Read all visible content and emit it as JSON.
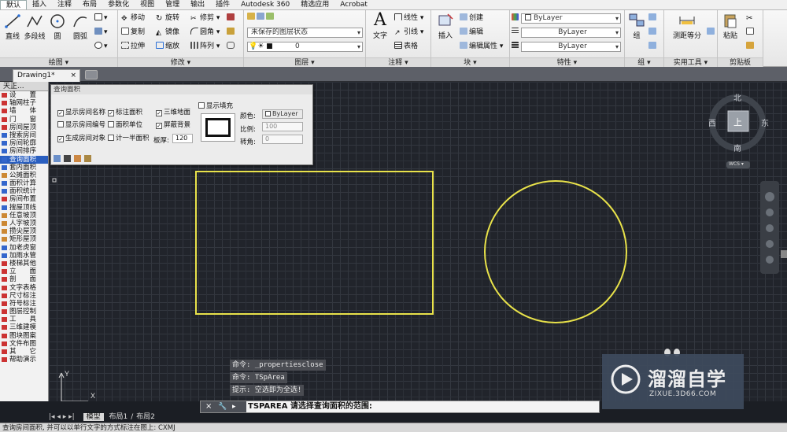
{
  "menu": [
    "默认",
    "插入",
    "注释",
    "布局",
    "参数化",
    "视图",
    "管理",
    "输出",
    "插件",
    "Autodesk 360",
    "精选应用",
    "Acrobat"
  ],
  "ribbon": {
    "draw": {
      "title": "绘图 ▾",
      "line": "直线",
      "polyline": "多段线",
      "circle": "圆",
      "arc": "圆弧"
    },
    "modify": {
      "title": "修改 ▾",
      "move": "移动",
      "rotate": "旋转",
      "trim": "修剪 ▾",
      "copy": "复制",
      "mirror": "镜像",
      "fillet": "圆角 ▾",
      "stretch": "拉伸",
      "scale": "缩放",
      "array": "阵列 ▾"
    },
    "layer": {
      "title": "图层 ▾",
      "state": "未保存的图层状态",
      "current": "0"
    },
    "annotation": {
      "title": "注释 ▾",
      "text": "文字",
      "linetype": "线性 ▾",
      "leader": "引线 ▾",
      "table": "表格"
    },
    "block": {
      "title": "块 ▾",
      "insert": "插入",
      "create": "创建",
      "edit": "编辑",
      "editattr": "编辑属性 ▾"
    },
    "properties": {
      "title": "特性 ▾",
      "color": "ByLayer",
      "linetype": "ByLayer",
      "lineweight": "ByLayer"
    },
    "group": {
      "title": "组 ▾",
      "label": "组"
    },
    "utilities": {
      "title": "实用工具 ▾",
      "measure": "测距等分"
    },
    "clipboard": {
      "title": "剪贴板",
      "paste": "粘贴"
    }
  },
  "doc_tab": "Drawing1*",
  "palette": {
    "title": "天正...",
    "items": [
      {
        "label": "设　　置",
        "color": "#cc3333"
      },
      {
        "label": "轴网柱子",
        "color": "#cc3333"
      },
      {
        "label": "墙　　体",
        "color": "#cc3333"
      },
      {
        "label": "门　　窗",
        "color": "#cc3333"
      },
      {
        "label": "房间屋顶",
        "color": "#cc3333"
      },
      {
        "label": "搜索房间",
        "color": "#3366cc"
      },
      {
        "label": "房间轮廓",
        "color": "#3366cc"
      },
      {
        "label": "房间排序",
        "color": "#3366cc"
      },
      {
        "label": "查询面积",
        "color": "#3366cc"
      },
      {
        "label": "套内面积",
        "color": "#3366cc"
      },
      {
        "label": "公摊面积",
        "color": "#cc8833"
      },
      {
        "label": "面积计算",
        "color": "#3366cc"
      },
      {
        "label": "面积统计",
        "color": "#3366cc"
      },
      {
        "label": "房间布置",
        "color": "#cc3333"
      },
      {
        "label": "搜屋顶线",
        "color": "#3366cc"
      },
      {
        "label": "任意坡顶",
        "color": "#cc8833"
      },
      {
        "label": "人字坡顶",
        "color": "#cc8833"
      },
      {
        "label": "攒尖屋顶",
        "color": "#cc8833"
      },
      {
        "label": "矩形屋顶",
        "color": "#cc8833"
      },
      {
        "label": "加老虎窗",
        "color": "#3366cc"
      },
      {
        "label": "加雨水管",
        "color": "#3366cc"
      },
      {
        "label": "楼梯其他",
        "color": "#cc3333"
      },
      {
        "label": "立　　面",
        "color": "#cc3333"
      },
      {
        "label": "剖　　面",
        "color": "#cc3333"
      },
      {
        "label": "文字表格",
        "color": "#cc3333"
      },
      {
        "label": "尺寸标注",
        "color": "#cc3333"
      },
      {
        "label": "符号标注",
        "color": "#cc3333"
      },
      {
        "label": "图层控制",
        "color": "#cc3333"
      },
      {
        "label": "工　　具",
        "color": "#cc3333"
      },
      {
        "label": "三维建模",
        "color": "#cc3333"
      },
      {
        "label": "图块图案",
        "color": "#cc3333"
      },
      {
        "label": "文件布图",
        "color": "#cc3333"
      },
      {
        "label": "其　　它",
        "color": "#cc3333"
      },
      {
        "label": "帮助演示",
        "color": "#cc3333"
      }
    ],
    "selected_index": 8
  },
  "dialog": {
    "title": "查询面积",
    "show_room_name": "显示房间名称",
    "mark_area": "标注面积",
    "3d_floor": "三维地面",
    "show_fill": "显示填充",
    "show_room_no": "显示房间编号",
    "area_unit": "面积单位",
    "mask_bg": "屏蔽背景",
    "gen_room_obj": "生成房间对象",
    "half_area": "计一半面积",
    "thickness_label": "板厚:",
    "thickness": "120",
    "color_label": "颜色:",
    "color_value": "ByLayer",
    "scale_label": "比例:",
    "scale_value": "100",
    "rotate_label": "转角:",
    "rotate_value": "0"
  },
  "compass": {
    "n": "北",
    "s": "南",
    "w": "西",
    "e": "东",
    "top": "上",
    "wcs": "WCS ▾"
  },
  "command": {
    "history": [
      "命令: _propertiesclose",
      "命令: TSpArea",
      "提示: 空选即为全选!"
    ],
    "prompt": "TSPAREA 请选择查询面积的范围:"
  },
  "layout_tabs": [
    "模型",
    "布局1",
    "布局2"
  ],
  "status_text": "查询房间面积, 并可以以单行文字的方式标注在图上: CXMJ",
  "watermark": {
    "title": "溜溜自学",
    "url": "ZIXUE.3D66.COM"
  },
  "colors": {
    "shape": "#e8e24a",
    "canvas": "#21242b",
    "accent": "#2a5fc0"
  }
}
